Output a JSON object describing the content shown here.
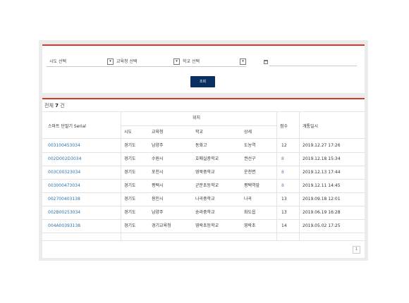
{
  "filters": {
    "region_label": "시도 선택",
    "office_label": "교육청 선택",
    "school_label": "학교 선택",
    "search_button": "조회"
  },
  "result": {
    "total_prefix": "전체",
    "total_count": "7",
    "total_suffix": "건",
    "headers": {
      "serial": "스마트 단말기 Serial",
      "location": "위치",
      "sido": "시도",
      "office": "교육청",
      "school": "학교",
      "detail": "상세",
      "score": "점수",
      "opened": "개통일시"
    },
    "rows": [
      {
        "serial": "003100453034",
        "sido": "경기도",
        "office": "남양주",
        "school": "동화고",
        "detail": "도농역",
        "score": "12",
        "date": "2019.12.27 17:26"
      },
      {
        "serial": "002D002D3034",
        "sido": "경기도",
        "office": "수원시",
        "school": "호매실중학교",
        "detail": "권선구",
        "score": "8",
        "date": "2019.12.18 15:34"
      },
      {
        "serial": "003C00323034",
        "sido": "경기도",
        "office": "포천시",
        "school": "영북중학교",
        "detail": "운천면",
        "score": "8",
        "date": "2019.12.13 17:44"
      },
      {
        "serial": "003000473034",
        "sido": "경기도",
        "office": "평택시",
        "school": "군문초등학교",
        "detail": "평택역앞",
        "score": "8",
        "date": "2019.12.11 14:45"
      },
      {
        "serial": "002700403138",
        "sido": "경기도",
        "office": "용인시",
        "school": "나곡중학교",
        "detail": "나곡",
        "score": "13",
        "date": "2019.09.18 12:01"
      },
      {
        "serial": "002B00253034",
        "sido": "경기도",
        "office": "남양주",
        "school": "송라중학교",
        "detail": "화도읍",
        "score": "13",
        "date": "2019.06.19 16:28"
      },
      {
        "serial": "004A00393138",
        "sido": "경기도",
        "office": "경기교육청",
        "school": "영락초등학교",
        "detail": "영락초",
        "score": "14",
        "date": "2019.05.02 17:25"
      }
    ],
    "page": "1"
  }
}
